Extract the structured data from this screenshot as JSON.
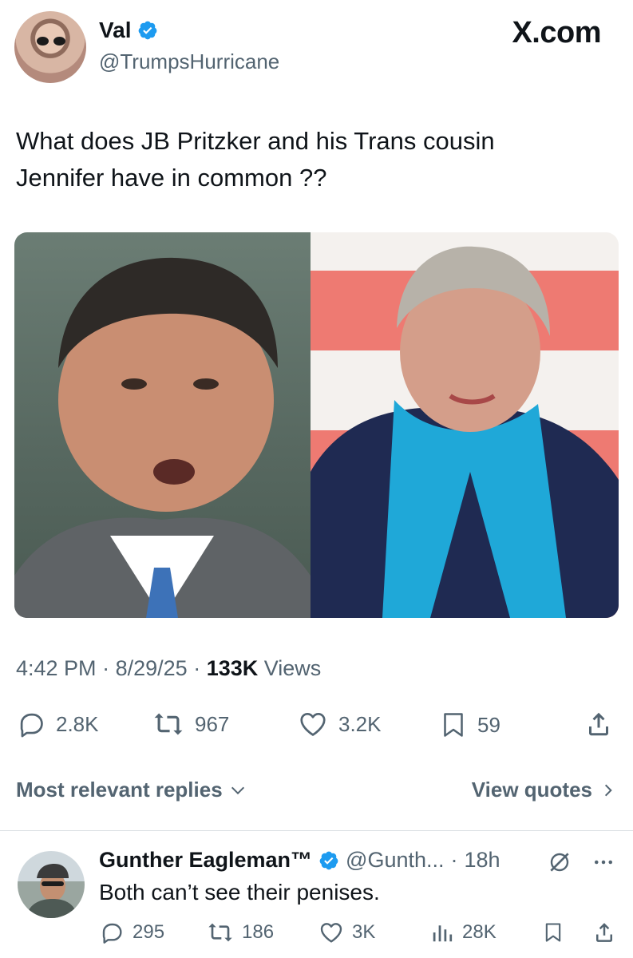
{
  "post": {
    "author": {
      "display_name": "Val",
      "handle": "@TrumpsHurricane",
      "verified": true
    },
    "brand": "X.com",
    "text_line1": "What does JB Pritzker and his Trans cousin",
    "text_line2": "Jennifer have in common ??",
    "meta": {
      "time": "4:42 PM",
      "date": "8/29/25",
      "views_count": "133K",
      "views_label": "Views"
    },
    "actions": {
      "replies": "2.8K",
      "reposts": "967",
      "likes": "3.2K",
      "bookmarks": "59"
    }
  },
  "replies_bar": {
    "sort_label": "Most relevant replies",
    "view_quotes_label": "View quotes"
  },
  "reply": {
    "display_name": "Gunther Eagleman™",
    "handle": "@Gunth...",
    "age": "18h",
    "text": "Both can’t see their penises.",
    "actions": {
      "replies": "295",
      "reposts": "186",
      "likes": "3K",
      "views": "28K"
    }
  },
  "colors": {
    "accent": "#1d9bf0",
    "text": "#0f1419",
    "muted": "#536471",
    "divider": "#d9dee2"
  }
}
